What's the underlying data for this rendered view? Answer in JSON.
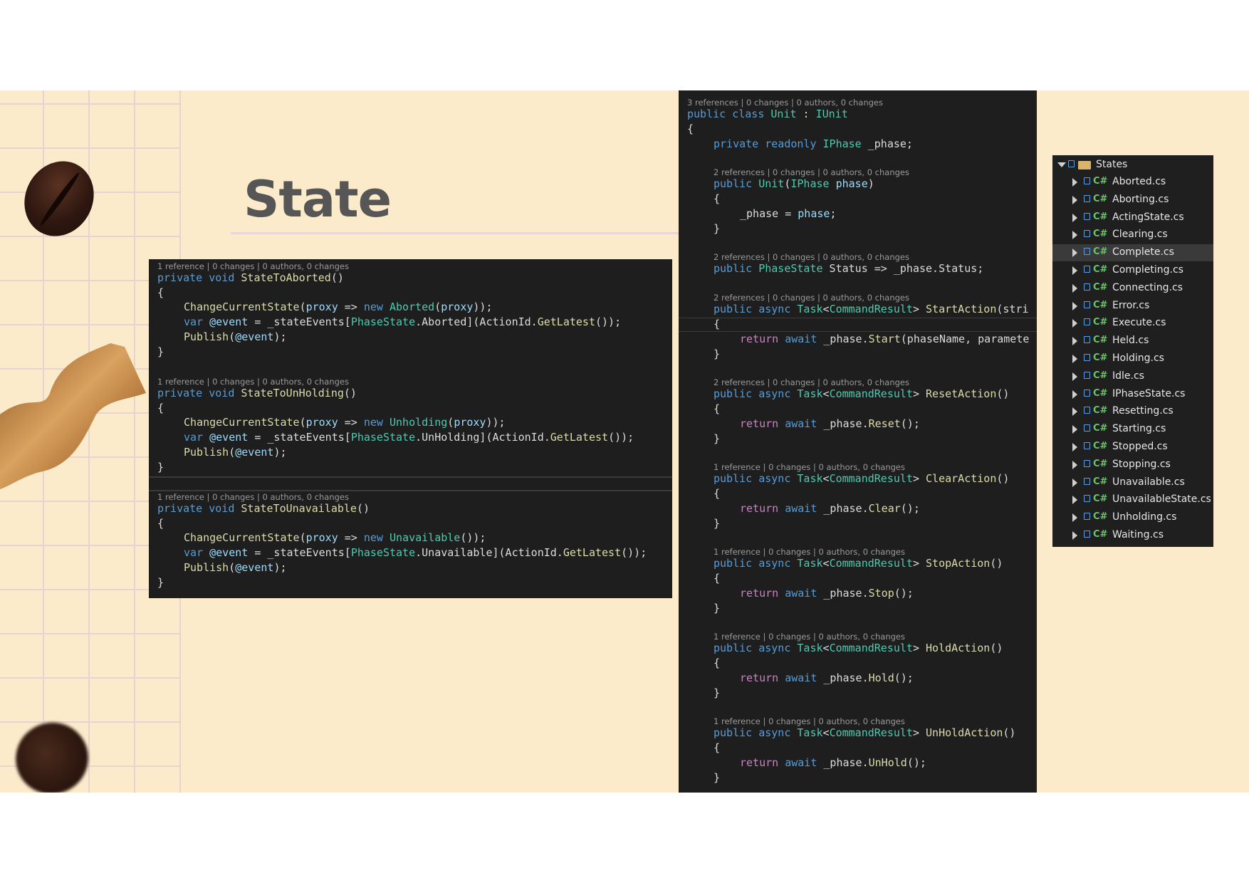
{
  "slide": {
    "title": "State",
    "colors": {
      "background": "#fcebcb",
      "title": "#575656",
      "code_bg": "#1e1e1e",
      "keyword": "#569cd6",
      "type": "#4ec9b0",
      "method": "#dcdcaa",
      "param": "#9cdcfe"
    }
  },
  "left_code": {
    "blocks": [
      {
        "lens": "1 reference | 0 changes | 0 authors, 0 changes",
        "signature": {
          "mod": "private",
          "ret": "void",
          "name": "StateToAborted",
          "args": "()"
        },
        "open": "{",
        "l1": {
          "fn": "ChangeCurrentState",
          "a": "(",
          "p": "proxy",
          "arrow": " => ",
          "new": "new",
          "ty": "Aborted",
          "b": "(",
          "p2": "proxy",
          "c": "));"
        },
        "l2": {
          "var": "var",
          "ev": "@event",
          "a": " = _stateEvents[",
          "ty": "PhaseState",
          "b": ".Aborted](ActionId.",
          "fn": "GetLatest",
          "c": "());"
        },
        "l3": {
          "fn": "Publish",
          "a": "(",
          "ev": "@event",
          "c": ");"
        },
        "close": "}"
      },
      {
        "lens": "1 reference | 0 changes | 0 authors, 0 changes",
        "signature": {
          "mod": "private",
          "ret": "void",
          "name": "StateToUnHolding",
          "args": "()"
        },
        "open": "{",
        "l1": {
          "fn": "ChangeCurrentState",
          "a": "(",
          "p": "proxy",
          "arrow": " => ",
          "new": "new",
          "ty": "Unholding",
          "b": "(",
          "p2": "proxy",
          "c": "));"
        },
        "l2": {
          "var": "var",
          "ev": "@event",
          "a": " = _stateEvents[",
          "ty": "PhaseState",
          "b": ".UnHolding](ActionId.",
          "fn": "GetLatest",
          "c": "());"
        },
        "l3": {
          "fn": "Publish",
          "a": "(",
          "ev": "@event",
          "c": ");"
        },
        "close": "}"
      },
      {
        "lens": "1 reference | 0 changes | 0 authors, 0 changes",
        "signature": {
          "mod": "private",
          "ret": "void",
          "name": "StateToUnavailable",
          "args": "()"
        },
        "open": "{",
        "l1": {
          "fn": "ChangeCurrentState",
          "a": "(",
          "p": "proxy",
          "arrow": " => ",
          "new": "new",
          "ty": "Unavailable",
          "b": "(",
          "p2": "",
          "c": "));"
        },
        "l2": {
          "var": "var",
          "ev": "@event",
          "a": " = _stateEvents[",
          "ty": "PhaseState",
          "b": ".Unavailable](ActionId.",
          "fn": "GetLatest",
          "c": "());"
        },
        "l3": {
          "fn": "Publish",
          "a": "(",
          "ev": "@event",
          "c": ");"
        },
        "close": "}"
      }
    ]
  },
  "right_code": {
    "class_lens": "3 references | 0 changes | 0 authors, 0 changes",
    "class_decl": {
      "kw": "public class",
      "name": " Unit",
      "sep": " : ",
      "iface": "IUnit"
    },
    "open": "{",
    "field": {
      "kw": "private readonly",
      "ty": " IPhase",
      "name": " _phase;"
    },
    "ctor_lens": "2 references | 0 changes | 0 authors, 0 changes",
    "ctor": {
      "kw": "public",
      "name": " Unit",
      "a": "(",
      "ty": "IPhase",
      "p": " phase",
      "b": ")"
    },
    "ctor_open": "{",
    "ctor_body": {
      "a": "_phase = ",
      "p": "phase",
      "b": ";"
    },
    "ctor_close": "}",
    "status_lens": "2 references | 0 changes | 0 authors, 0 changes",
    "status": {
      "kw": "public",
      "ty": " PhaseState",
      "name": " Status => _phase.Status;"
    },
    "methods": [
      {
        "lens": "2 references | 0 changes | 0 authors, 0 changes",
        "kw": "public async",
        "task": " Task",
        "lt": "<",
        "res": "CommandResult",
        "gt": ">",
        "name": " StartAction",
        "args": "(stri",
        "body_call": "Start",
        "body_args": "(phaseName, paramete"
      },
      {
        "lens": "2 references | 0 changes | 0 authors, 0 changes",
        "kw": "public async",
        "task": " Task",
        "lt": "<",
        "res": "CommandResult",
        "gt": ">",
        "name": " ResetAction",
        "args": "()",
        "body_call": "Reset",
        "body_args": "();"
      },
      {
        "lens": "1 reference | 0 changes | 0 authors, 0 changes",
        "kw": "public async",
        "task": " Task",
        "lt": "<",
        "res": "CommandResult",
        "gt": ">",
        "name": " ClearAction",
        "args": "()",
        "body_call": "Clear",
        "body_args": "();"
      },
      {
        "lens": "1 reference | 0 changes | 0 authors, 0 changes",
        "kw": "public async",
        "task": " Task",
        "lt": "<",
        "res": "CommandResult",
        "gt": ">",
        "name": " StopAction",
        "args": "()",
        "body_call": "Stop",
        "body_args": "();"
      },
      {
        "lens": "1 reference | 0 changes | 0 authors, 0 changes",
        "kw": "public async",
        "task": " Task",
        "lt": "<",
        "res": "CommandResult",
        "gt": ">",
        "name": " HoldAction",
        "args": "()",
        "body_call": "Hold",
        "body_args": "();"
      },
      {
        "lens": "1 reference | 0 changes | 0 authors, 0 changes",
        "kw": "public async",
        "task": " Task",
        "lt": "<",
        "res": "CommandResult",
        "gt": ">",
        "name": " UnHoldAction",
        "args": "()",
        "body_call": "UnHold",
        "body_args": "();"
      }
    ],
    "method_ret": "return",
    "method_await": " await",
    "method_obj": " _phase.",
    "brace_open": "{",
    "brace_close": "}"
  },
  "explorer": {
    "folder": "States",
    "lang_badge": "C#",
    "files": [
      "Aborted.cs",
      "Aborting.cs",
      "ActingState.cs",
      "Clearing.cs",
      "Complete.cs",
      "Completing.cs",
      "Connecting.cs",
      "Error.cs",
      "Execute.cs",
      "Held.cs",
      "Holding.cs",
      "Idle.cs",
      "IPhaseState.cs",
      "Resetting.cs",
      "Starting.cs",
      "Stopped.cs",
      "Stopping.cs",
      "Unavailable.cs",
      "UnavailableState.cs",
      "Unholding.cs",
      "Waiting.cs"
    ],
    "selected": "Complete.cs"
  }
}
